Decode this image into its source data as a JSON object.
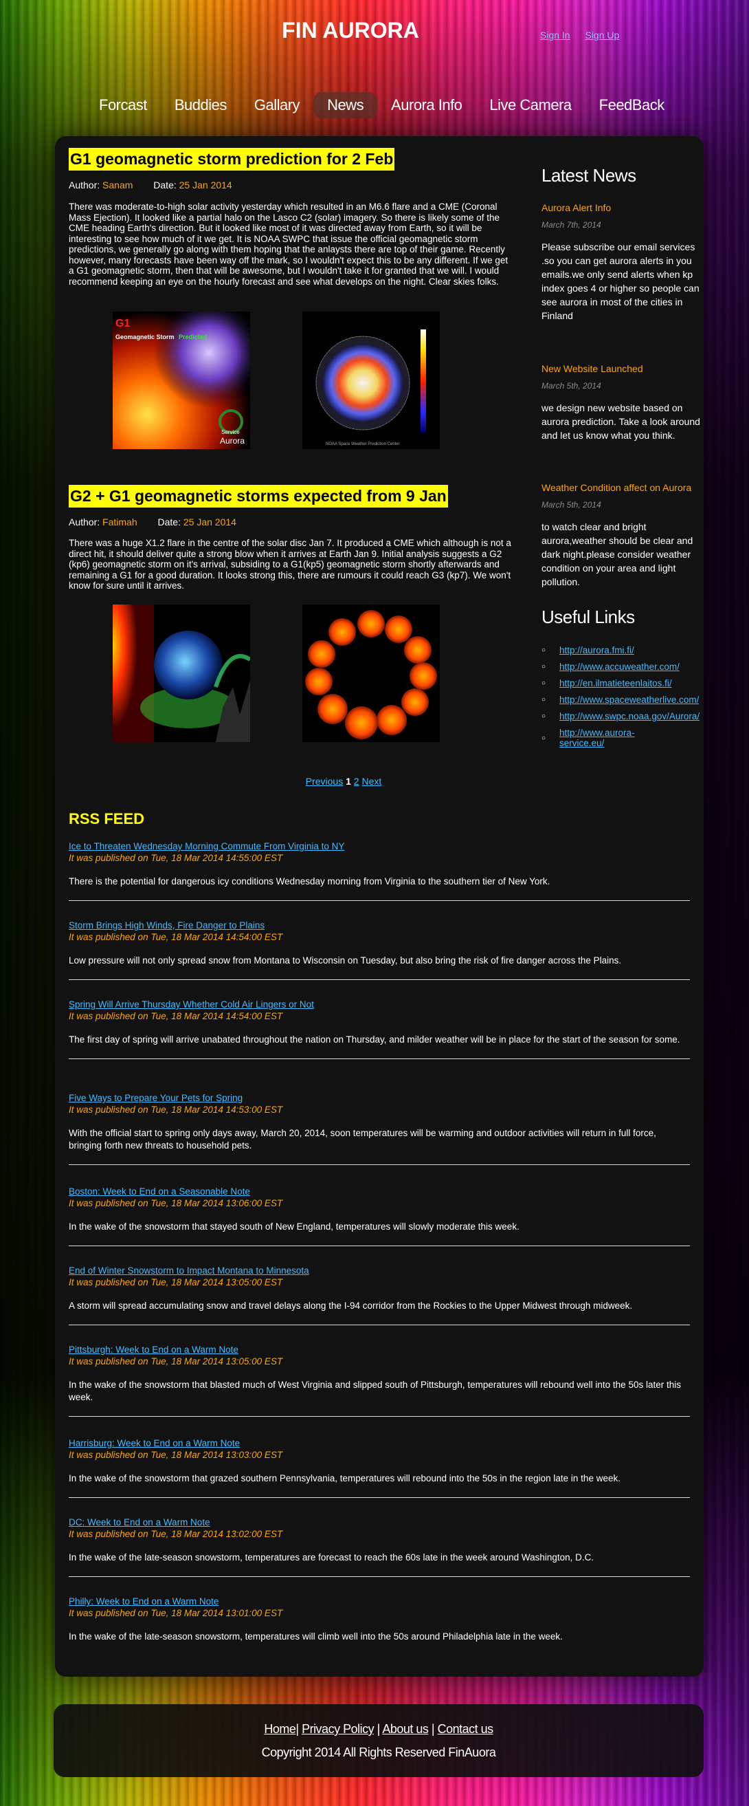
{
  "site": {
    "title": "FIN AURORA",
    "sign_in": "Sign In",
    "sign_up": "Sign Up"
  },
  "nav": {
    "items": [
      {
        "label": "Forcast"
      },
      {
        "label": "Buddies"
      },
      {
        "label": "Gallary"
      },
      {
        "label": "News"
      },
      {
        "label": "Aurora Info"
      },
      {
        "label": "Live Camera"
      },
      {
        "label": "FeedBack"
      }
    ],
    "active": "News"
  },
  "articles": [
    {
      "title": "G1 geomagnetic storm prediction for 2 Feb",
      "author_label": "Author:",
      "author": "Sanam",
      "date_label": "Date:",
      "date": "25 Jan 2014",
      "body": "There was moderate-to-high solar activity yesterday which resulted in an M6.6 flare and a CME (Coronal Mass Ejection). It looked like a partial halo on the Lasco C2 (solar) imagery. So there is likely some of the CME heading Earth's direction. But it looked like most of it was directed away from Earth, so it will be interesting to see how much of it we get. It is NOAA SWPC that issue the official geomagnetic storm predictions, we generally go along with them hoping that the anlaysts there are top of their game. Recently however, many forecasts have been way off the mark, so I wouldn't expect this to be any different. If we get a G1 geomagnetic storm, then that will be awesome, but I wouldn't take it for granted that we will. I would recommend keeping an eye on the hourly forecast and see what develops on the night. Clear skies folks.",
      "image1": {
        "text_g1": "G1",
        "text_storm": "Geomagnetic Storm",
        "text_pred": "Predicted",
        "text_service": "Service",
        "text_aurora": "Aurora"
      },
      "image2": {
        "caption": "NOAA Space Weather Prediction Center"
      }
    },
    {
      "title": "G2 + G1 geomagnetic storms expected from 9 Jan",
      "author_label": "Author:",
      "author": "Fatimah",
      "date_label": "Date:",
      "date": "25 Jan 2014",
      "body": "There was a huge X1.2 flare in the centre of the solar disc Jan 7. It produced a CME which although is not a direct hit, it should deliver quite a strong blow when it arrives at Earth Jan 9. Initial analysis suggests a G2 (kp6) geomagnetic storm on it's arrival, subsiding to a G1(kp5) geomagnetic storm shortly afterwards and remaining a G1 for a good duration. It looks strong this, there are rumours it could reach G3 (kp7). We won't know for sure until it arrives."
    }
  ],
  "pager": {
    "previous": "Previous",
    "current": "1",
    "page2": "2",
    "next": "Next"
  },
  "sidebar": {
    "news_heading": "Latest News",
    "news": [
      {
        "title": "Aurora Alert Info",
        "date": "March 7th, 2014",
        "text": "Please subscribe our email services .so you can get aurora alerts in you emails.we only send alerts when kp index goes 4 or higher so people can see aurora in most of the cities in Finland"
      },
      {
        "title": "New Website Launched",
        "date": "March 5th, 2014",
        "text": "we design new website based on aurora prediction. Take a look around and let us know what you think."
      },
      {
        "title": "Weather Condition affect on Aurora",
        "date": "March 5th, 2014",
        "text": "to watch clear and bright aurora,weather should be clear and dark night.please consider weather condition on your area and light pollution."
      }
    ],
    "links_heading": "Useful Links",
    "links": [
      "http://aurora.fmi.fi/",
      "http://www.accuweather.com/",
      "http://en.ilmatieteenlaitos.fi/",
      "http://www.spaceweatherlive.com/",
      "http://www.swpc.noaa.gov/Aurora/",
      "http://www.aurora-service.eu/"
    ]
  },
  "rss": {
    "heading": "RSS FEED",
    "items": [
      {
        "title": "Ice to Threaten Wednesday Morning Commute From Virginia to NY",
        "published": "It was published on Tue, 18 Mar 2014 14:55:00 EST",
        "desc": "There is the potential for dangerous icy conditions Wednesday morning from Virginia to the southern tier of New York."
      },
      {
        "title": "Storm Brings High Winds, Fire Danger to Plains",
        "published": "It was published on Tue, 18 Mar 2014 14:54:00 EST",
        "desc": "Low pressure will not only spread snow from Montana to Wisconsin on Tuesday, but also bring the risk of fire danger across the Plains."
      },
      {
        "title": "Spring Will Arrive Thursday Whether Cold Air Lingers or Not",
        "published": "It was published on Tue, 18 Mar 2014 14:54:00 EST",
        "desc": "The first day of spring will arrive unabated throughout the nation on Thursday, and milder weather will be in place for the start of the season for some."
      },
      {
        "title": "Five Ways to Prepare Your Pets for Spring",
        "published": "It was published on Tue, 18 Mar 2014 14:53:00 EST",
        "desc": "With the official start to spring only days away, March 20, 2014, soon temperatures will be warming and outdoor activities will return in full force, bringing forth new threats to household pets."
      },
      {
        "title": "Boston: Week to End on a Seasonable Note",
        "published": "It was published on Tue, 18 Mar 2014 13:06:00 EST",
        "desc": "In the wake of the snowstorm that stayed south of New England, temperatures will slowly moderate this week."
      },
      {
        "title": "End of Winter Snowstorm to Impact Montana to Minnesota",
        "published": "It was published on Tue, 18 Mar 2014 13:05:00 EST",
        "desc": "A storm will spread accumulating snow and travel delays along the I-94 corridor from the Rockies to the Upper Midwest through midweek."
      },
      {
        "title": "Pittsburgh: Week to End on a Warm Note",
        "published": "It was published on Tue, 18 Mar 2014 13:05:00 EST",
        "desc": "In the wake of the snowstorm that blasted much of West Virginia and slipped south of Pittsburgh, temperatures will rebound well into the 50s later this week."
      },
      {
        "title": "Harrisburg: Week to End on a Warm Note",
        "published": "It was published on Tue, 18 Mar 2014 13:03:00 EST",
        "desc": "In the wake of the snowstorm that grazed southern Pennsylvania, temperatures will rebound into the 50s in the region late in the week."
      },
      {
        "title": "DC: Week to End on a Warm Note",
        "published": "It was published on Tue, 18 Mar 2014 13:02:00 EST",
        "desc": "In the wake of the late-season snowstorm, temperatures are forecast to reach the 60s late in the week around Washington, D.C."
      },
      {
        "title": "Philly: Week to End on a Warm Note",
        "published": "It was published on Tue, 18 Mar 2014 13:01:00 EST",
        "desc": "In the wake of the late-season snowstorm, temperatures will climb well into the 50s around Philadelphia late in the week."
      }
    ]
  },
  "footer": {
    "home": "Home",
    "privacy": "Privacy Policy",
    "about": "About us",
    "contact": "Contact us",
    "separator": "|",
    "copyright": "Copyright 2014 All Rights Reserved FinAuora"
  }
}
